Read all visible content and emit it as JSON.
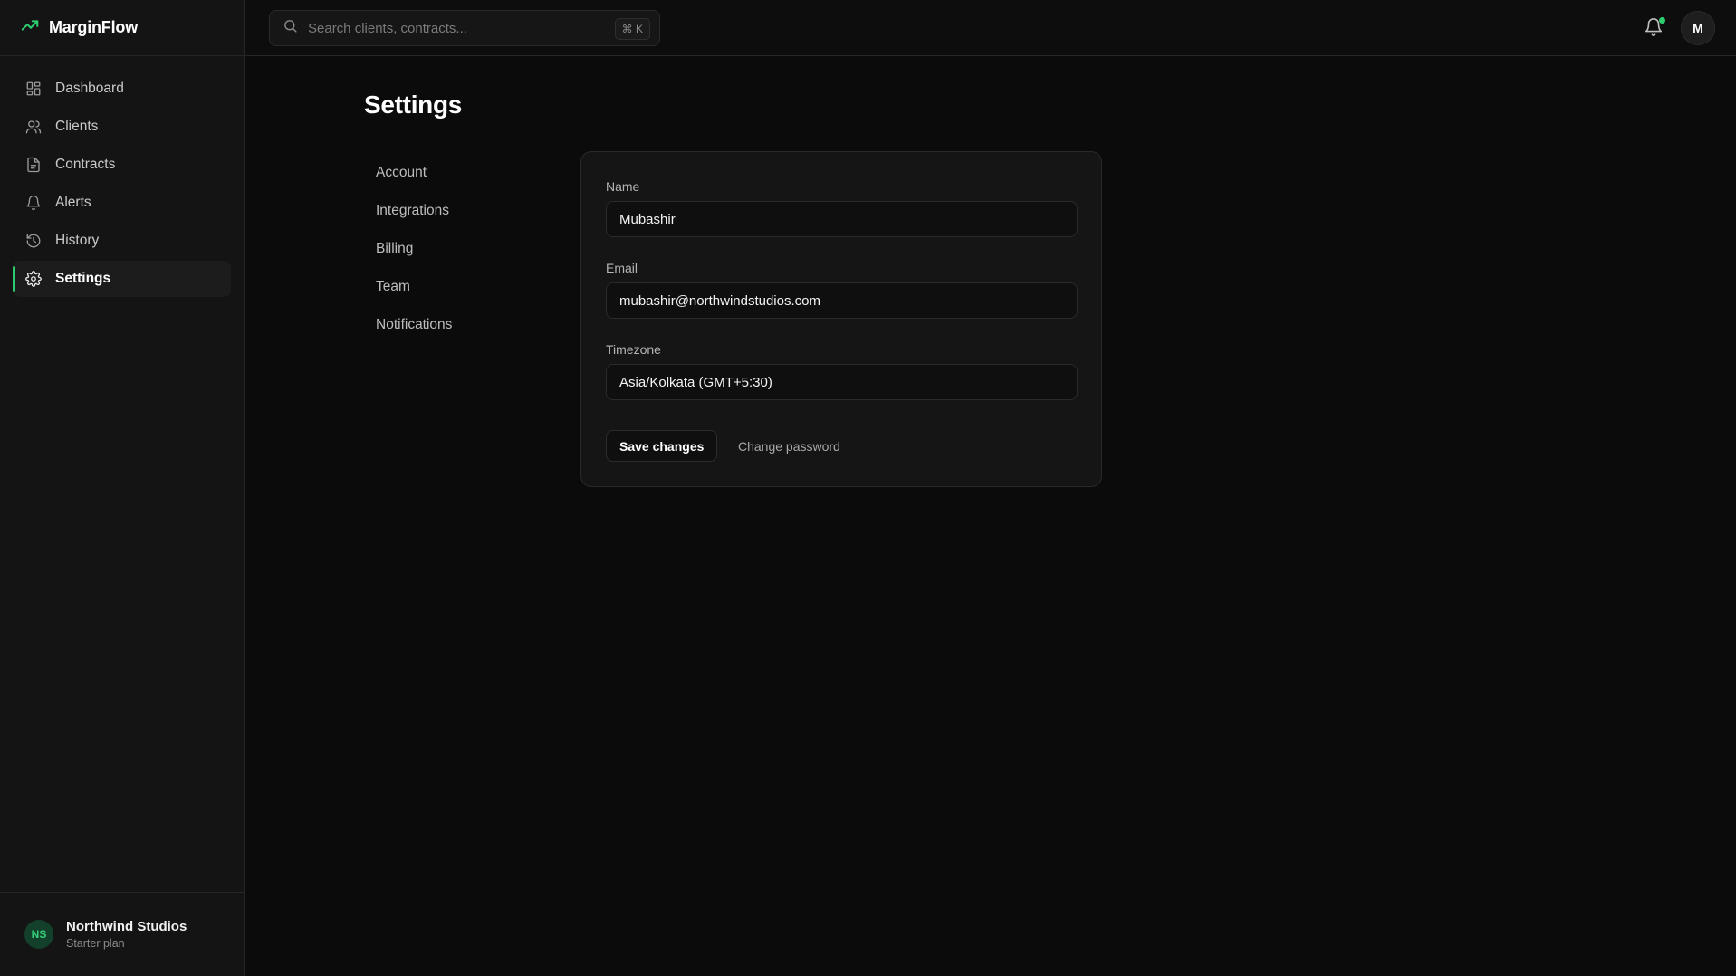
{
  "brand": {
    "name": "MarginFlow",
    "logo_icon": "trending-up-icon",
    "accent": "#2ecc71"
  },
  "sidebar": {
    "items": [
      {
        "label": "Dashboard",
        "icon": "grid-icon"
      },
      {
        "label": "Clients",
        "icon": "users-icon"
      },
      {
        "label": "Contracts",
        "icon": "document-icon"
      },
      {
        "label": "Alerts",
        "icon": "bell-icon"
      },
      {
        "label": "History",
        "icon": "history-icon"
      },
      {
        "label": "Settings",
        "icon": "gear-icon",
        "active": true
      }
    ],
    "org": {
      "initials": "NS",
      "name": "Northwind Studios",
      "plan": "Starter plan"
    }
  },
  "topbar": {
    "search_placeholder": "Search clients, contracts...",
    "search_value": "",
    "shortcut": "⌘ K",
    "user_initial": "M",
    "notification_dot": true
  },
  "page": {
    "title": "Settings",
    "subnav": [
      "Account",
      "Integrations",
      "Billing",
      "Team",
      "Notifications"
    ]
  },
  "form": {
    "name_label": "Name",
    "name_value": "Mubashir",
    "email_label": "Email",
    "email_value": "mubashir@northwindstudios.com",
    "timezone_label": "Timezone",
    "timezone_value": "Asia/Kolkata (GMT+5:30)",
    "save_label": "Save changes",
    "change_password_label": "Change password"
  }
}
